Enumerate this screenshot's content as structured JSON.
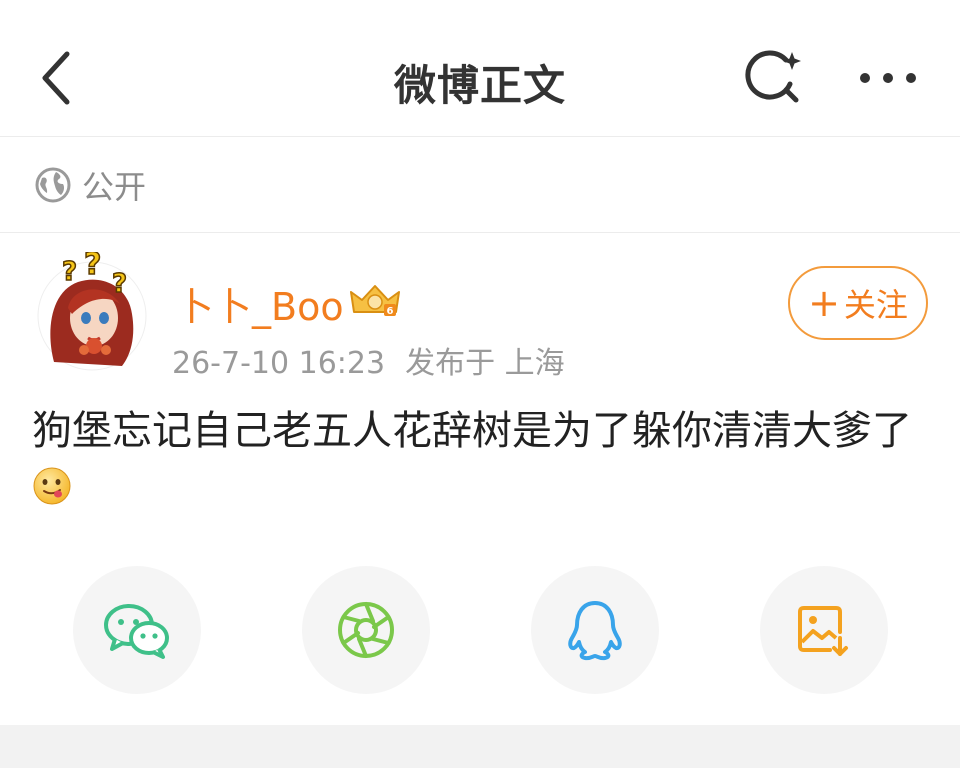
{
  "header": {
    "title": "微博正文",
    "back_icon": "chevron-left-icon",
    "search_icon": "search-sparkle-icon",
    "more_icon": "more-horizontal-icon"
  },
  "visibility": {
    "icon": "globe-icon",
    "label": "公开"
  },
  "post": {
    "author": {
      "name": "卜卜_Boo",
      "avatar": "avatar",
      "badge": "vip-crown-icon"
    },
    "time": "26-7-10 16:23",
    "location": "发布于 上海",
    "follow_label": "关注",
    "text": "狗堡忘记自己老五人花辞树是为了躲你清清大爹了",
    "emoji": "tongue-out-emoji"
  },
  "share_targets": [
    {
      "name": "wechat",
      "icon": "wechat-icon",
      "color": "#3fc089"
    },
    {
      "name": "moments",
      "icon": "moments-icon",
      "color": "#7bc84a"
    },
    {
      "name": "qq",
      "icon": "qq-icon",
      "color": "#39a4ea"
    },
    {
      "name": "save-image",
      "icon": "save-image-icon",
      "color": "#f4a21f"
    }
  ],
  "colors": {
    "accent": "#f27d1f",
    "meta_text": "#9a9a9a",
    "divider": "#ececec"
  }
}
